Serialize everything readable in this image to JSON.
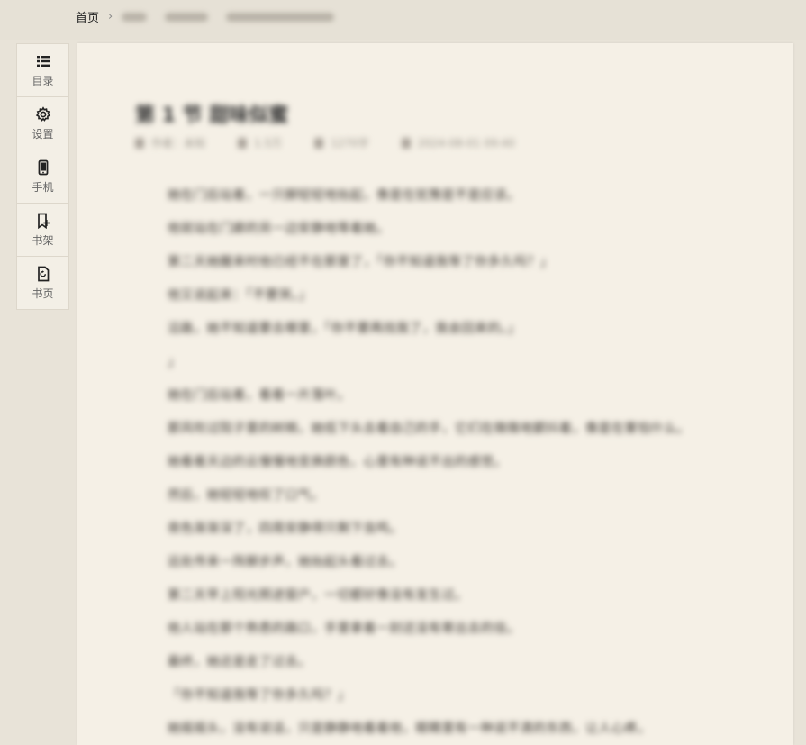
{
  "breadcrumb": {
    "home": "首页",
    "sep": "›"
  },
  "sidebar": {
    "items": [
      {
        "label": "目录",
        "icon": "list-icon"
      },
      {
        "label": "设置",
        "icon": "gear-icon"
      },
      {
        "label": "手机",
        "icon": "phone-icon"
      },
      {
        "label": "书架",
        "icon": "bookshelf-add-icon"
      },
      {
        "label": "书页",
        "icon": "book-page-icon"
      }
    ]
  },
  "content": {
    "title": "第 1 节 甜味似蜜",
    "meta": [
      "作者：未知",
      "1.5万",
      "1270字",
      "2024-08-01 09:40"
    ],
    "paragraphs": [
      "她在门后站着，一只脚轻轻地抬起，像是在犹豫是不是应该。",
      "他就站在门廊的另一边安静地等着她。",
      "第二天她醒来时他已经不在那里了，「你不知道我等了你多久吗？」",
      "他又说起来：「不要哭。」",
      "沿路，她不知道要去哪里，「你不要再找我了，我会回来的。」",
      "」",
      "她在门后站着，看着一片落叶。",
      "那风吹过院子里的树梢，她低下头去看自己的手，它们在微微地颤抖着，像是在害怕什么。",
      "她看着天边的云慢慢地变换颜色，心里有种说不出的感觉。",
      "然后，她轻轻地叹了口气。",
      "夜色渐渐深了，四周安静得只剩下虫鸣。",
      "远处传来一阵脚步声，她抬起头看过去。",
      "第二天早上阳光照进窗户，一切都好像没有发生过。",
      "他人站在那个熟悉的路口，手里拿着一封还没有寄出去的信。",
      "最终，她还是走了过去。",
      "「你不知道我等了你多久吗？」",
      "她摇摇头，没有说话，只是静静地看着他，眼睛里有一种说不清的东西，让人心疼。"
    ]
  }
}
